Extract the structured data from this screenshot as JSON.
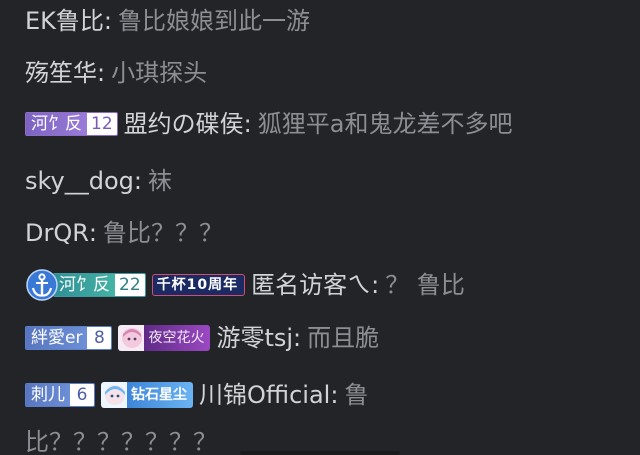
{
  "messages": [
    {
      "user": "EK鲁比",
      "colon": ":",
      "text": "鲁比娘娘到此一游"
    },
    {
      "user": "殇笙华",
      "colon": ":",
      "text": "小琪探头"
    },
    {
      "medal": {
        "name": "河饣反",
        "level": "12"
      },
      "user": "盟约の碟侯",
      "colon": ":",
      "text": "狐狸平a和鬼龙差不多吧"
    },
    {
      "user": "sky__dog",
      "colon": ":",
      "text": "袜"
    },
    {
      "user": "DrQR",
      "colon": ":",
      "text": "鲁比？？？"
    },
    {
      "medal": {
        "name": "河饣反",
        "level": "22"
      },
      "badge": "千杯10周年",
      "user": "匿名访客ㄟ",
      "colon": ":",
      "text": "？ 鲁比"
    },
    {
      "medal": {
        "name": "絆愛er",
        "level": "8"
      },
      "badge": "夜空花火",
      "user": "游零tsj",
      "colon": ":",
      "text": "而且脆"
    },
    {
      "medal": {
        "name": "刺儿",
        "level": "6"
      },
      "badge": "钻石星尘",
      "user": "川锦Official",
      "colon": ":",
      "text": "鲁"
    },
    {
      "text": "比？？？？？？？"
    }
  ],
  "colors": {
    "background": "#232427",
    "username": "#d2d3d6",
    "message": "#8c8e93"
  },
  "icons": {
    "guard": "anchor-icon"
  }
}
